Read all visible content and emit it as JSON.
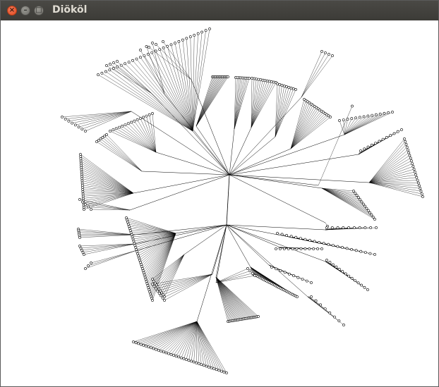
{
  "window": {
    "title": "Diököl",
    "controls": {
      "close_icon": "close-icon",
      "minimize_icon": "minimize-icon",
      "maximize_icon": "maximize-icon",
      "close_glyph": "×",
      "minimize_glyph": "–",
      "maximize_glyph": "□"
    }
  },
  "graph": {
    "type": "radial-tree",
    "edge_color": "#000000",
    "node_fill": "#ffffff",
    "node_stroke": "#000000"
  }
}
